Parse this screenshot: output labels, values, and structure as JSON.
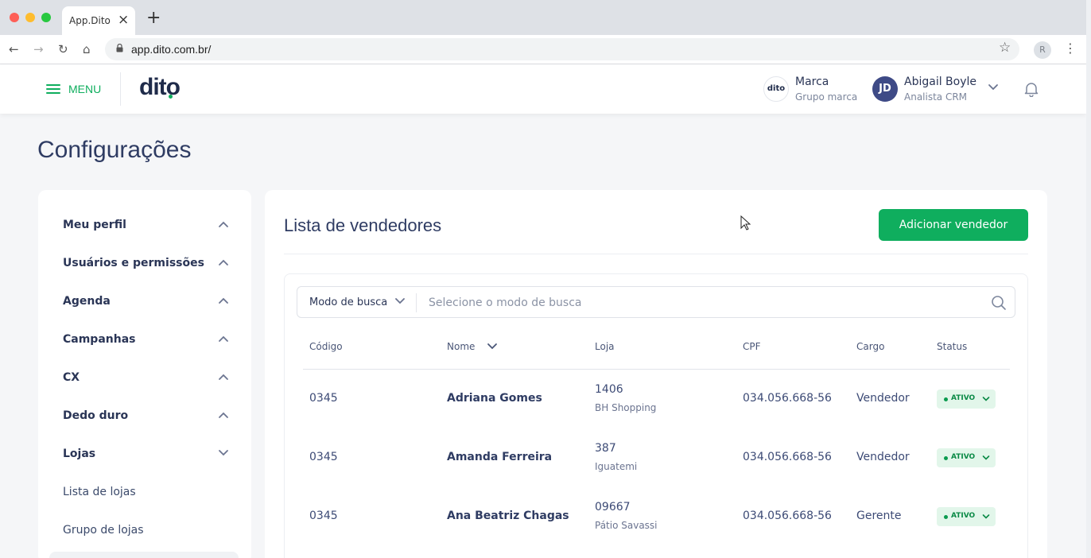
{
  "browser": {
    "tab_title": "App.Dito",
    "url": "app.dito.com.br/",
    "profile_initial": "R"
  },
  "header": {
    "menu_label": "MENU",
    "logo_text": "dito",
    "brand": {
      "avatar_text": "dito",
      "name": "Marca",
      "subtitle": "Grupo marca"
    },
    "user": {
      "initials": "JD",
      "name": "Abigail Boyle",
      "role": "Analista CRM"
    }
  },
  "page": {
    "title": "Configurações"
  },
  "sidebar": {
    "items": [
      {
        "label": "Meu perfil",
        "chevron": "up"
      },
      {
        "label": "Usuários e permissões",
        "chevron": "up"
      },
      {
        "label": "Agenda",
        "chevron": "up"
      },
      {
        "label": "Campanhas",
        "chevron": "up"
      },
      {
        "label": "CX",
        "chevron": "up"
      },
      {
        "label": "Dedo duro",
        "chevron": "up"
      },
      {
        "label": "Lojas",
        "chevron": "down"
      }
    ],
    "subitems": [
      {
        "label": "Lista de lojas"
      },
      {
        "label": "Grupo de lojas"
      }
    ]
  },
  "panel": {
    "title": "Lista de vendedores",
    "add_button": "Adicionar vendedor",
    "search": {
      "mode_label": "Modo de busca",
      "placeholder": "Selecione o modo de busca"
    },
    "columns": [
      "Código",
      "Nome",
      "Loja",
      "CPF",
      "Cargo",
      "Status"
    ],
    "rows": [
      {
        "codigo": "0345",
        "nome": "Adriana Gomes",
        "loja_num": "1406",
        "loja_nome": "BH Shopping",
        "cpf": "034.056.668-56",
        "cargo": "Vendedor",
        "status": "ATIVO"
      },
      {
        "codigo": "0345",
        "nome": "Amanda Ferreira",
        "loja_num": "387",
        "loja_nome": "Iguatemi",
        "cpf": "034.056.668-56",
        "cargo": "Vendedor",
        "status": "ATIVO"
      },
      {
        "codigo": "0345",
        "nome": "Ana Beatriz Chagas",
        "loja_num": "09667",
        "loja_nome": "Pátio Savassi",
        "cpf": "034.056.668-56",
        "cargo": "Gerente",
        "status": "ATIVO"
      }
    ]
  },
  "colors": {
    "accent_green": "#0fae5e",
    "status_bg": "#e2f6ea",
    "title_navy": "#2f3c63",
    "avatar_blue": "#3e4a86"
  }
}
